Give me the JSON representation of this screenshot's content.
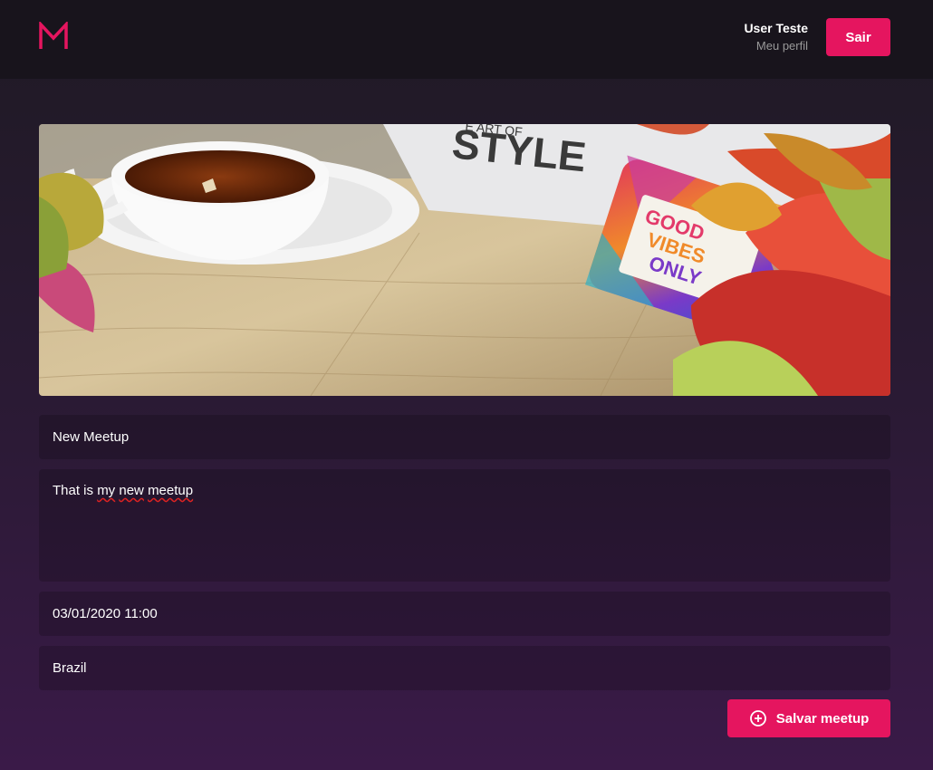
{
  "header": {
    "user_name": "User Teste",
    "profile_link": "Meu perfil",
    "logout_label": "Sair"
  },
  "form": {
    "title_value": "New Meetup",
    "description_prefix": "That is ",
    "description_words": [
      "my",
      "new",
      "meetup"
    ],
    "date_value": "03/01/2020 11:00",
    "location_value": "Brazil",
    "save_label": "Salvar meetup"
  },
  "banner": {
    "magazine_text": "STYLE",
    "magazine_small": "E ART OF",
    "phone_text": [
      "GOOD",
      "VIBES",
      "ONLY"
    ]
  },
  "colors": {
    "accent": "#e5155f",
    "header_bg": "#18141c",
    "bg_top": "#1f1a24",
    "bg_bottom": "#3a1a48"
  },
  "icons": [
    "logo-m-icon",
    "add-circle-icon"
  ]
}
